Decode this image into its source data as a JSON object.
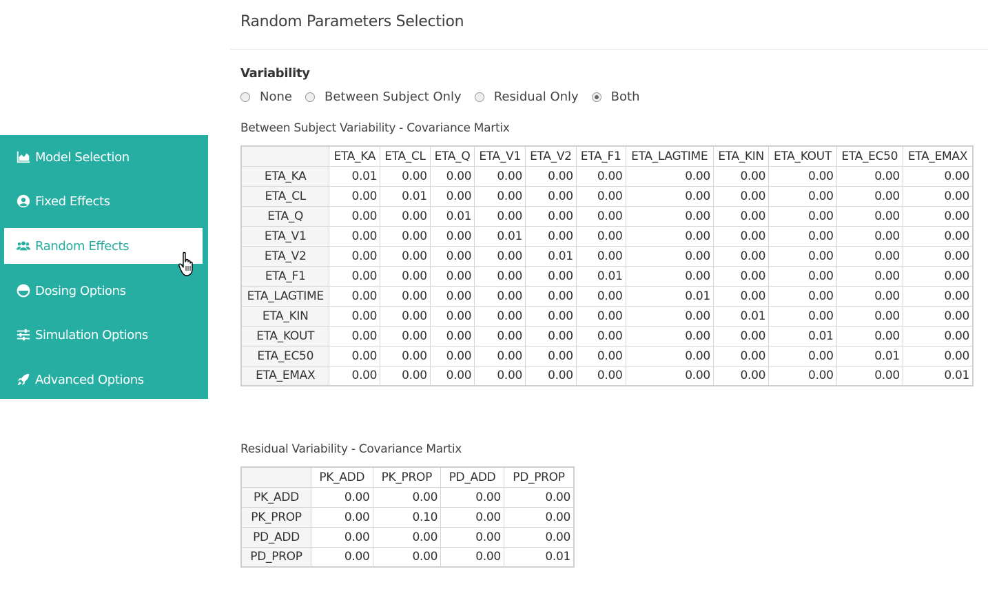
{
  "sidebar": {
    "items": [
      {
        "label": "Model Selection",
        "icon": "chart-area-icon",
        "active": false
      },
      {
        "label": "Fixed Effects",
        "icon": "user-circle-icon",
        "active": false
      },
      {
        "label": "Random Effects",
        "icon": "users-icon",
        "active": true
      },
      {
        "label": "Dosing Options",
        "icon": "half-circle-icon",
        "active": false
      },
      {
        "label": "Simulation Options",
        "icon": "sliders-icon",
        "active": false
      },
      {
        "label": "Advanced Options",
        "icon": "rocket-icon",
        "active": false
      }
    ],
    "bg_color": "#26aea2",
    "active_text_color": "#26aea2"
  },
  "main": {
    "title": "Random Parameters Selection",
    "variability_label": "Variability",
    "variability_options": [
      "None",
      "Between Subject Only",
      "Residual Only",
      "Both"
    ],
    "variability_selected": "Both",
    "bsv": {
      "label": "Between Subject Variability - Covariance Martix",
      "columns": [
        "ETA_KA",
        "ETA_CL",
        "ETA_Q",
        "ETA_V1",
        "ETA_V2",
        "ETA_F1",
        "ETA_LAGTIME",
        "ETA_KIN",
        "ETA_KOUT",
        "ETA_EC50",
        "ETA_EMAX"
      ],
      "rows": [
        {
          "name": "ETA_KA",
          "values": [
            "0.01",
            "0.00",
            "0.00",
            "0.00",
            "0.00",
            "0.00",
            "0.00",
            "0.00",
            "0.00",
            "0.00",
            "0.00"
          ]
        },
        {
          "name": "ETA_CL",
          "values": [
            "0.00",
            "0.01",
            "0.00",
            "0.00",
            "0.00",
            "0.00",
            "0.00",
            "0.00",
            "0.00",
            "0.00",
            "0.00"
          ]
        },
        {
          "name": "ETA_Q",
          "values": [
            "0.00",
            "0.00",
            "0.01",
            "0.00",
            "0.00",
            "0.00",
            "0.00",
            "0.00",
            "0.00",
            "0.00",
            "0.00"
          ]
        },
        {
          "name": "ETA_V1",
          "values": [
            "0.00",
            "0.00",
            "0.00",
            "0.01",
            "0.00",
            "0.00",
            "0.00",
            "0.00",
            "0.00",
            "0.00",
            "0.00"
          ]
        },
        {
          "name": "ETA_V2",
          "values": [
            "0.00",
            "0.00",
            "0.00",
            "0.00",
            "0.01",
            "0.00",
            "0.00",
            "0.00",
            "0.00",
            "0.00",
            "0.00"
          ]
        },
        {
          "name": "ETA_F1",
          "values": [
            "0.00",
            "0.00",
            "0.00",
            "0.00",
            "0.00",
            "0.01",
            "0.00",
            "0.00",
            "0.00",
            "0.00",
            "0.00"
          ]
        },
        {
          "name": "ETA_LAGTIME",
          "values": [
            "0.00",
            "0.00",
            "0.00",
            "0.00",
            "0.00",
            "0.00",
            "0.01",
            "0.00",
            "0.00",
            "0.00",
            "0.00"
          ]
        },
        {
          "name": "ETA_KIN",
          "values": [
            "0.00",
            "0.00",
            "0.00",
            "0.00",
            "0.00",
            "0.00",
            "0.00",
            "0.01",
            "0.00",
            "0.00",
            "0.00"
          ]
        },
        {
          "name": "ETA_KOUT",
          "values": [
            "0.00",
            "0.00",
            "0.00",
            "0.00",
            "0.00",
            "0.00",
            "0.00",
            "0.00",
            "0.01",
            "0.00",
            "0.00"
          ]
        },
        {
          "name": "ETA_EC50",
          "values": [
            "0.00",
            "0.00",
            "0.00",
            "0.00",
            "0.00",
            "0.00",
            "0.00",
            "0.00",
            "0.00",
            "0.01",
            "0.00"
          ]
        },
        {
          "name": "ETA_EMAX",
          "values": [
            "0.00",
            "0.00",
            "0.00",
            "0.00",
            "0.00",
            "0.00",
            "0.00",
            "0.00",
            "0.00",
            "0.00",
            "0.01"
          ]
        }
      ]
    },
    "residual": {
      "label": "Residual Variability - Covariance Martix",
      "columns": [
        "PK_ADD",
        "PK_PROP",
        "PD_ADD",
        "PD_PROP"
      ],
      "rows": [
        {
          "name": "PK_ADD",
          "values": [
            "0.00",
            "0.00",
            "0.00",
            "0.00"
          ]
        },
        {
          "name": "PK_PROP",
          "values": [
            "0.00",
            "0.10",
            "0.00",
            "0.00"
          ]
        },
        {
          "name": "PD_ADD",
          "values": [
            "0.00",
            "0.00",
            "0.00",
            "0.00"
          ]
        },
        {
          "name": "PD_PROP",
          "values": [
            "0.00",
            "0.00",
            "0.00",
            "0.01"
          ]
        }
      ]
    }
  }
}
